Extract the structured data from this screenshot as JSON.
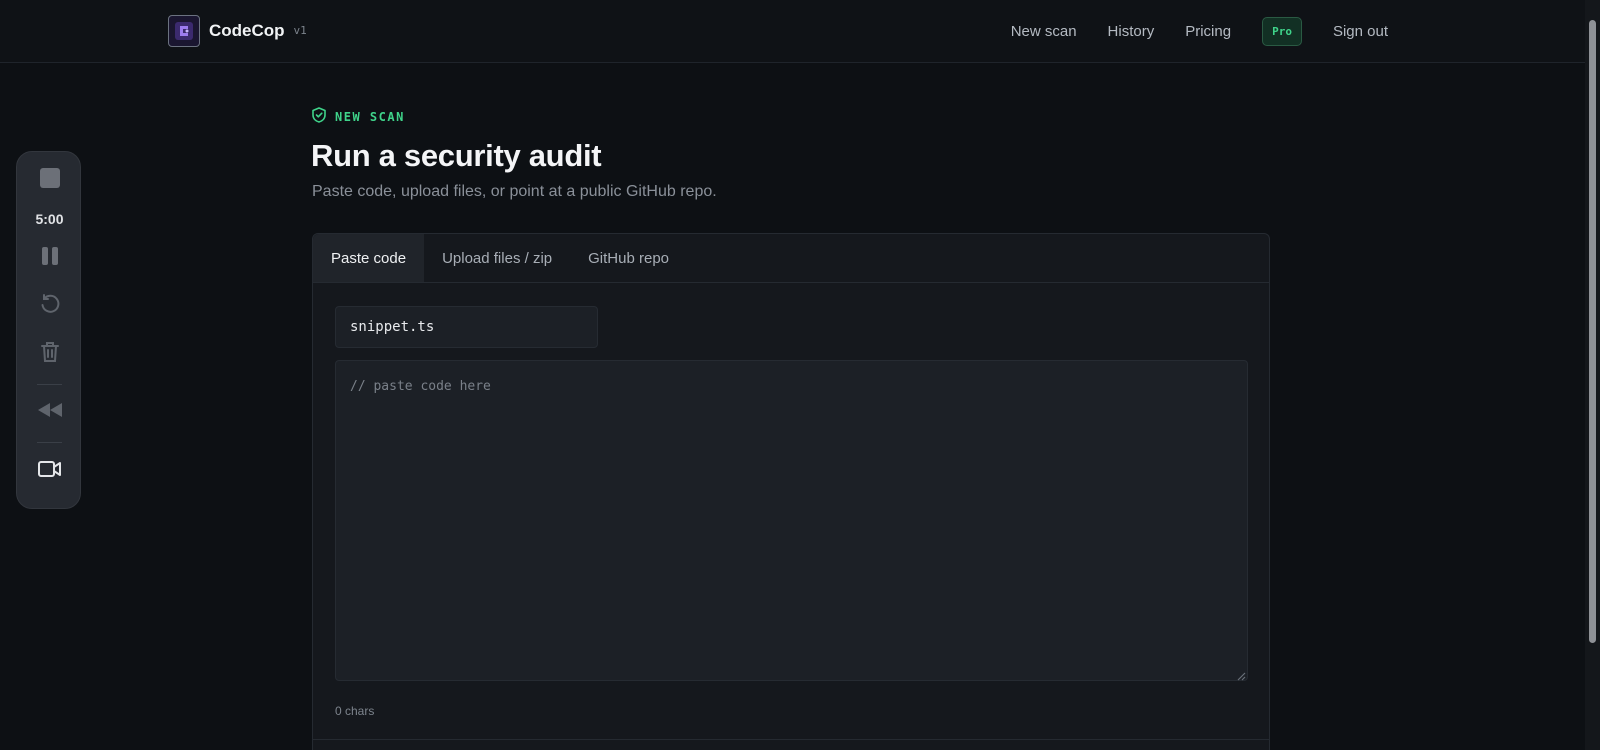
{
  "brand": {
    "name": "CodeCop",
    "version": "v1"
  },
  "nav": {
    "items": [
      "New scan",
      "History",
      "Pricing"
    ],
    "pro_label": "Pro",
    "signout_label": "Sign out"
  },
  "recorder": {
    "timer": "5:00"
  },
  "page": {
    "eyebrow": "NEW SCAN",
    "title": "Run a security audit",
    "subtitle": "Paste code, upload files, or point at a public GitHub repo."
  },
  "tabs": [
    {
      "label": "Paste code",
      "active": true
    },
    {
      "label": "Upload files / zip",
      "active": false
    },
    {
      "label": "GitHub repo",
      "active": false
    }
  ],
  "editor": {
    "filename": "snippet.ts",
    "code_value": "",
    "code_placeholder": "// paste code here",
    "char_count": "0 chars"
  },
  "colors": {
    "accent_green": "#3fd38a",
    "background": "#0d1014",
    "card": "#15181d"
  },
  "icons": {
    "brand": "codecop-logo",
    "eyebrow": "shield-icon",
    "recorder": [
      "stop-icon",
      "pause-icon",
      "restart-icon",
      "trash-icon",
      "rewind-icon",
      "camera-icon"
    ]
  }
}
